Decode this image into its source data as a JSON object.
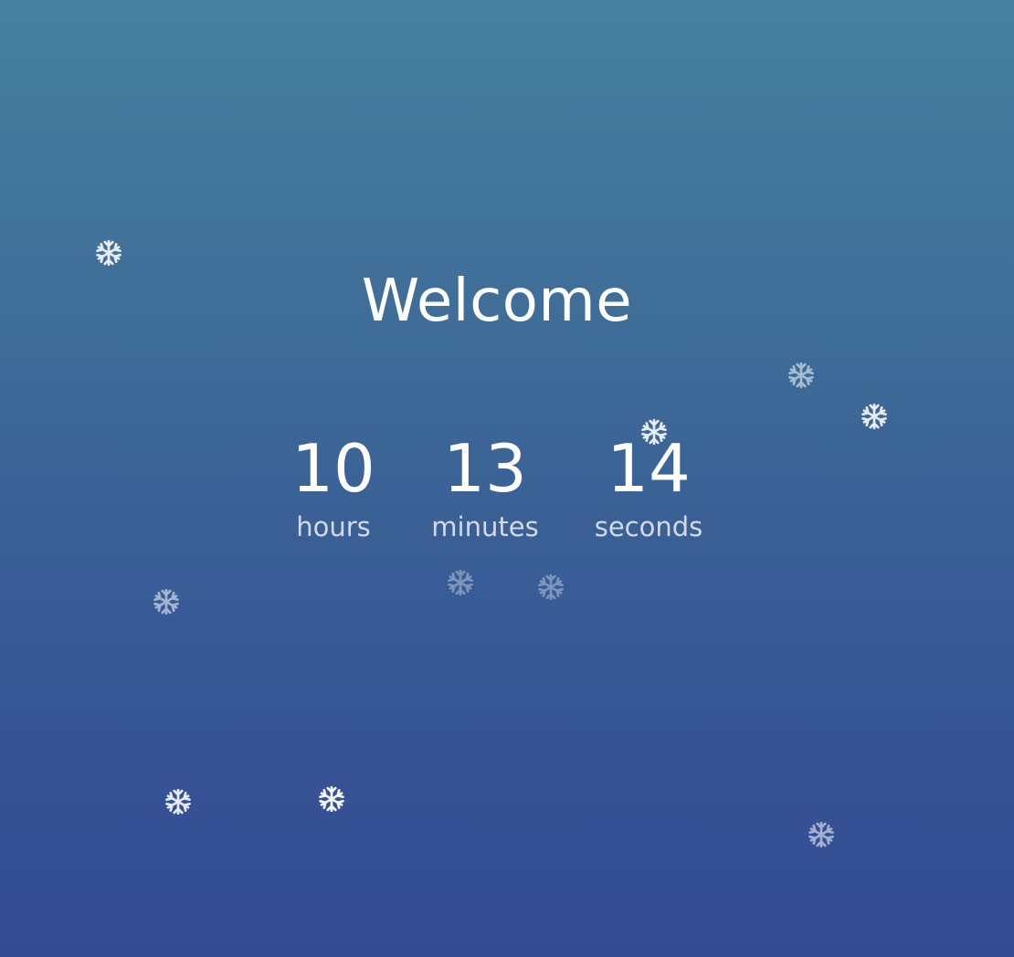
{
  "title": "Welcome",
  "countdown": {
    "hours": {
      "value": "10",
      "label": "hours"
    },
    "minutes": {
      "value": "13",
      "label": "minutes"
    },
    "seconds": {
      "value": "14",
      "label": "seconds"
    }
  },
  "decorations": {
    "icon": "snowflake-icon",
    "color": "#ffffff"
  },
  "colors": {
    "background_top": "#46819f",
    "background_bottom": "#334b93",
    "label_text": "#d3d9e6"
  }
}
